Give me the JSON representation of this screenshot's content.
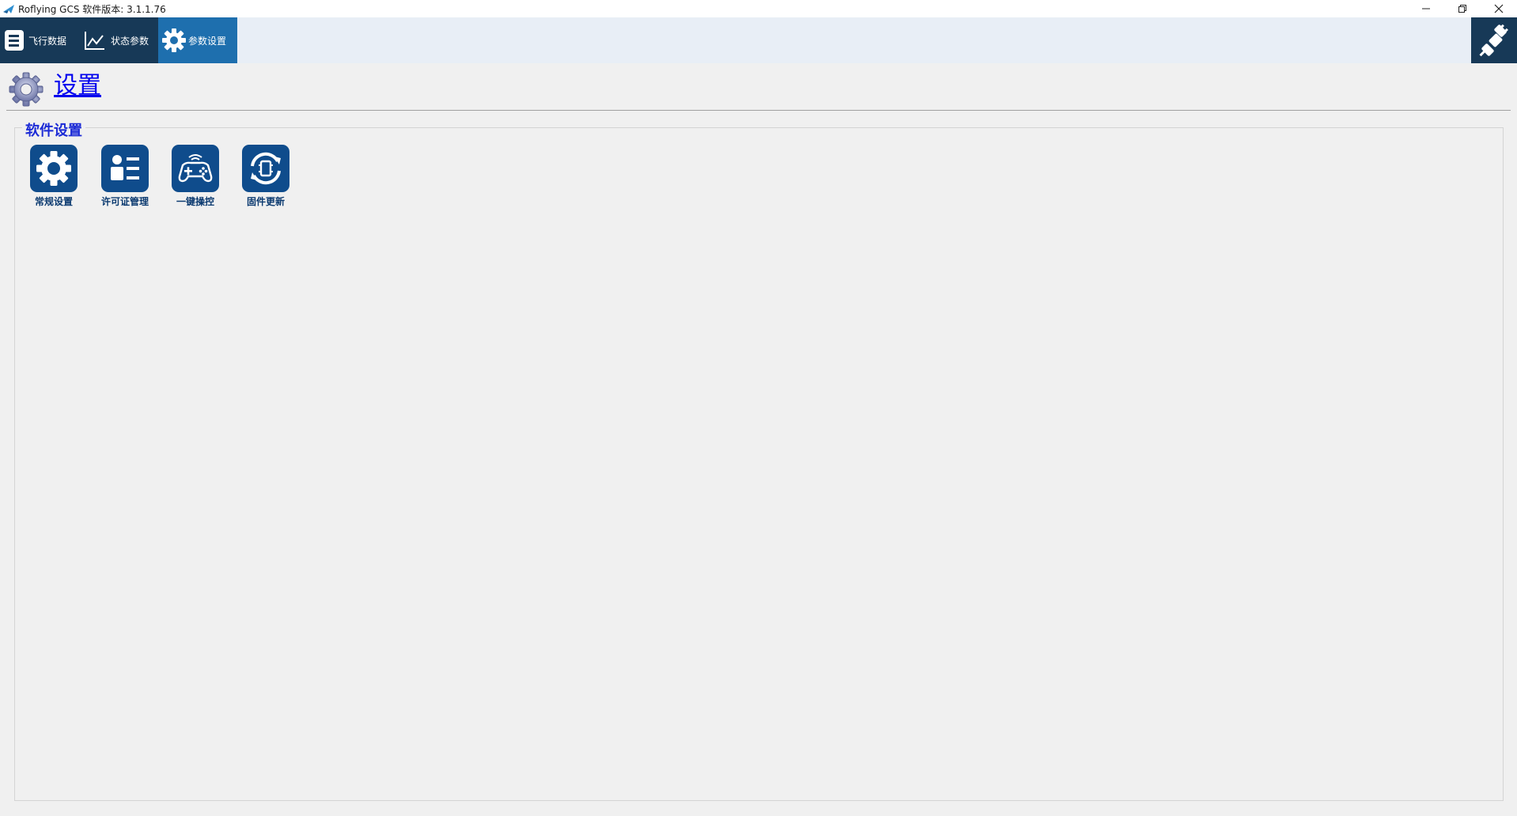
{
  "window": {
    "title": "Roflying GCS 软件版本: 3.1.1.76",
    "controls": {
      "minimize": "minimize-icon",
      "restore": "restore-icon",
      "close": "close-icon"
    }
  },
  "nav": {
    "items": [
      {
        "label": "飞行数据",
        "icon": "flight-data-icon"
      },
      {
        "label": "状态参数",
        "icon": "chart-line-icon"
      },
      {
        "label": "参数设置",
        "icon": "gear-icon",
        "active": true
      }
    ],
    "connect_icon": "disconnected-plug-icon"
  },
  "header": {
    "title": "设置",
    "icon": "gear-icon"
  },
  "group": {
    "legend": "软件设置",
    "tiles": [
      {
        "label": "常规设置",
        "icon": "gear-icon"
      },
      {
        "label": "许可证管理",
        "icon": "license-card-icon"
      },
      {
        "label": "一键操控",
        "icon": "gamepad-icon"
      },
      {
        "label": "固件更新",
        "icon": "firmware-update-icon"
      }
    ]
  },
  "colors": {
    "nav_bg": "#173957",
    "nav_active": "#1e6fae",
    "tile_bg": "#0f4c8c",
    "link": "#0000ee",
    "legend": "#1c2bd6"
  }
}
